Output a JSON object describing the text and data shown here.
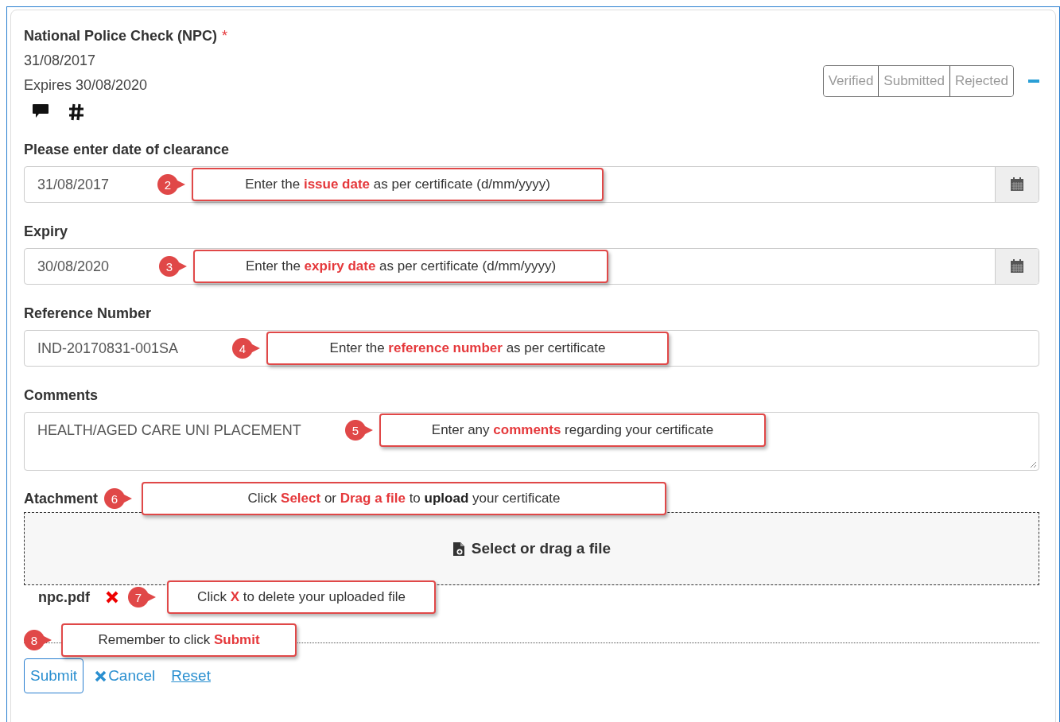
{
  "header": {
    "title": "National Police Check (NPC)",
    "required_mark": "*",
    "date": "31/08/2017",
    "expires": "Expires 30/08/2020"
  },
  "status_buttons": [
    {
      "label": "Verified",
      "selected": false
    },
    {
      "label": "Submitted",
      "selected": false
    },
    {
      "label": "Rejected",
      "selected": false
    }
  ],
  "fields": [
    {
      "kind": "date",
      "label": "Please enter date of clearance",
      "value": "31/08/2017",
      "callout": {
        "number": "2",
        "segments": [
          {
            "kind": "plain",
            "text": "Enter the "
          },
          {
            "kind": "highlight",
            "text": "issue date"
          },
          {
            "kind": "plain",
            "text": " as per certificate (d/mm/yyyy)"
          }
        ]
      }
    },
    {
      "kind": "date",
      "label": "Expiry",
      "value": "30/08/2020",
      "callout": {
        "number": "3",
        "segments": [
          {
            "kind": "plain",
            "text": "Enter the "
          },
          {
            "kind": "highlight",
            "text": "expiry date"
          },
          {
            "kind": "plain",
            "text": " as per certificate (d/mm/yyyy)"
          }
        ]
      }
    },
    {
      "kind": "text",
      "label": "Reference Number",
      "value": "IND-20170831-001SA",
      "callout": {
        "number": "4",
        "segments": [
          {
            "kind": "plain",
            "text": "Enter the "
          },
          {
            "kind": "highlight",
            "text": "reference number"
          },
          {
            "kind": "plain",
            "text": " as per certificate"
          }
        ]
      }
    },
    {
      "kind": "textarea",
      "label": "Comments",
      "value": "HEALTH/AGED CARE UNI PLACEMENT",
      "callout": {
        "number": "5",
        "segments": [
          {
            "kind": "plain",
            "text": "Enter any "
          },
          {
            "kind": "highlight",
            "text": "comments"
          },
          {
            "kind": "plain",
            "text": " regarding your certificate"
          }
        ]
      }
    }
  ],
  "attachment": {
    "label": "Atachment",
    "callout": {
      "number": "6",
      "segments": [
        {
          "kind": "plain",
          "text": "Click "
        },
        {
          "kind": "highlight",
          "text": "Select"
        },
        {
          "kind": "plain",
          "text": " or "
        },
        {
          "kind": "highlight",
          "text": "Drag a file"
        },
        {
          "kind": "plain",
          "text": " to "
        },
        {
          "kind": "strong",
          "text": "upload"
        },
        {
          "kind": "plain",
          "text": " your certificate"
        }
      ]
    },
    "dropzone": "Select or drag a file",
    "file": {
      "name": "npc.pdf",
      "callout": {
        "number": "7",
        "segments": [
          {
            "kind": "plain",
            "text": "Click "
          },
          {
            "kind": "highlight",
            "text": "X"
          },
          {
            "kind": "plain",
            "text": " to delete your uploaded file"
          }
        ]
      }
    }
  },
  "submit_callout": {
    "number": "8",
    "segments": [
      {
        "kind": "plain",
        "text": "Remember to click "
      },
      {
        "kind": "highlight",
        "text": "Submit"
      }
    ]
  },
  "actions": {
    "submit": "Submit",
    "cancel": "Cancel",
    "reset": "Reset"
  }
}
